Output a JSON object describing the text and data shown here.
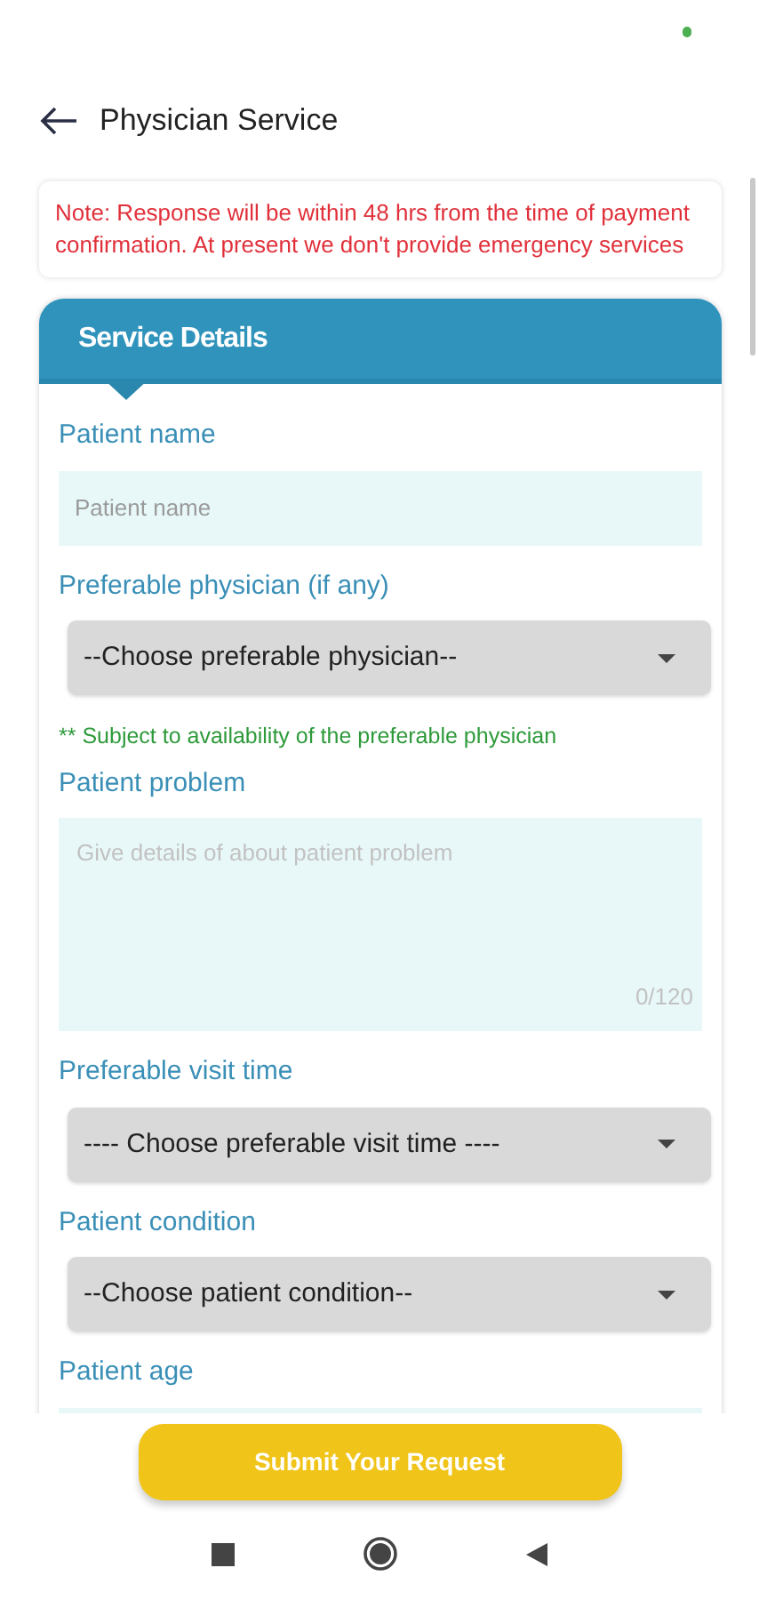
{
  "header": {
    "title": "Physician Service"
  },
  "note": "Note: Response will be within 48 hrs from the time of payment confirmation. At present we don't provide emergency services",
  "section": {
    "title": "Service Details"
  },
  "fields": [
    {
      "kind": "text",
      "label": "Patient name",
      "placeholder": "Patient name"
    },
    {
      "kind": "select",
      "label": "Preferable physician (if any)",
      "value": "--Choose preferable physician--",
      "hint": "** Subject to availability of the preferable physician"
    },
    {
      "kind": "textarea",
      "label": "Patient problem",
      "placeholder": "Give details of about patient problem",
      "counter": "0/120"
    },
    {
      "kind": "select",
      "label": "Preferable visit time",
      "value": "---- Choose preferable visit time ----"
    },
    {
      "kind": "select",
      "label": "Patient condition",
      "value": "--Choose patient condition--"
    },
    {
      "kind": "text",
      "label": "Patient age"
    }
  ],
  "submit_button": "Submit Your Request"
}
